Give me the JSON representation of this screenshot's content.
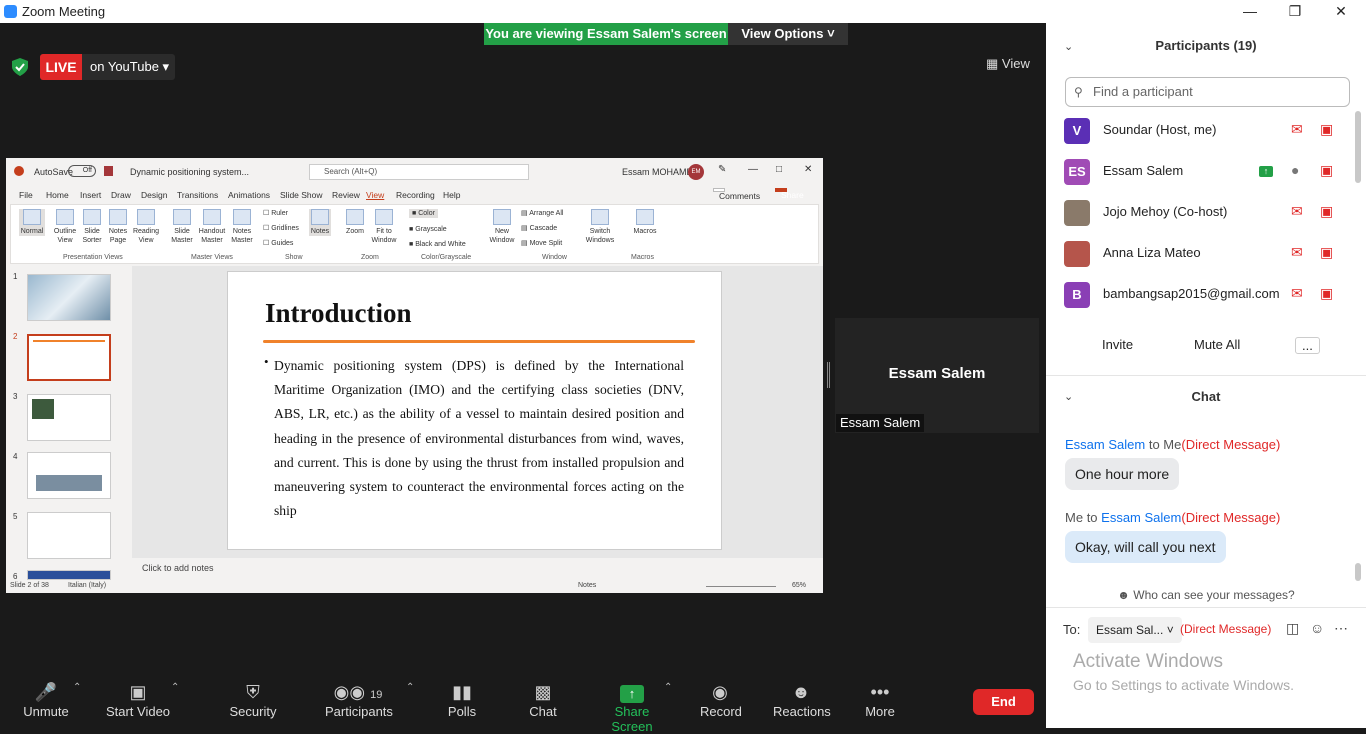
{
  "window": {
    "title": "Zoom Meeting"
  },
  "banner": {
    "viewing": "You are viewing Essam Salem's screen",
    "options": "View Options"
  },
  "live": {
    "badge": "LIVE",
    "platform": "on YouTube"
  },
  "view_label": "View",
  "ppt": {
    "autosave": "AutoSave",
    "off": "Off",
    "filename": "Dynamic positioning system...",
    "search": "Search (Alt+Q)",
    "user": "Essam MOHAMED",
    "user_initials": "EM",
    "menu": [
      "File",
      "Home",
      "Insert",
      "Draw",
      "Design",
      "Transitions",
      "Animations",
      "Slide Show",
      "Review",
      "View",
      "Recording",
      "Help"
    ],
    "comments": "Comments",
    "share": "Share",
    "ribbon": {
      "normal": "Normal",
      "outline": "Outline View",
      "sorter": "Slide Sorter",
      "notes_page": "Notes Page",
      "reading": "Reading View",
      "slide_master": "Slide Master",
      "handout": "Handout Master",
      "notes_master": "Notes Master",
      "ruler": "Ruler",
      "gridlines": "Gridlines",
      "guides": "Guides",
      "notes": "Notes",
      "zoom": "Zoom",
      "fit": "Fit to Window",
      "color": "Color",
      "grayscale": "Grayscale",
      "bw": "Black and White",
      "new_window": "New Window",
      "arrange": "Arrange All",
      "cascade": "Cascade",
      "move_split": "Move Split",
      "switch": "Switch Windows",
      "macros": "Macros",
      "groups": [
        "Presentation Views",
        "Master Views",
        "Show",
        "Zoom",
        "Color/Grayscale",
        "Window",
        "Macros"
      ]
    },
    "slide_numbers": [
      "1",
      "2",
      "3",
      "4",
      "5",
      "6"
    ],
    "slide": {
      "title": "Introduction",
      "body": "Dynamic positioning system (DPS) is defined by the International Maritime Organization (IMO) and the certifying class societies (DNV, ABS, LR, etc.) as the ability of a vessel to maintain desired position and heading in the presence of environmental disturbances from wind, waves, and current. This is done by using the thrust from installed propulsion and maneuvering system to counteract the environmental forces acting on the ship"
    },
    "notes_placeholder": "Click to add notes",
    "status": {
      "slide": "Slide 2 of 38",
      "lang": "Italian (Italy)",
      "notes": "Notes",
      "zoom": "65%"
    }
  },
  "tile": {
    "name": "Essam Salem",
    "label": "Essam Salem"
  },
  "toolbar": {
    "unmute": "Unmute",
    "video": "Start Video",
    "security": "Security",
    "participants": "Participants",
    "participants_count": "19",
    "polls": "Polls",
    "chat": "Chat",
    "share": "Share Screen",
    "record": "Record",
    "reactions": "Reactions",
    "more": "More",
    "end": "End"
  },
  "panel": {
    "participants_title": "Participants (19)",
    "search_placeholder": "Find a participant",
    "participants": [
      {
        "name": "Soundar (Host, me)",
        "initials": "V",
        "color": "#5b2fb5"
      },
      {
        "name": "Essam Salem",
        "initials": "ES",
        "color": "#a04bb5"
      },
      {
        "name": "Jojo Mehoy (Co-host)",
        "initials": "",
        "color": "#8a7a6a"
      },
      {
        "name": "Anna Liza Mateo",
        "initials": "",
        "color": "#b5554b"
      },
      {
        "name": "bambangsap2015@gmail.com",
        "initials": "B",
        "color": "#8a3fb5"
      }
    ],
    "invite": "Invite",
    "mute_all": "Mute All",
    "more": "...",
    "chat_title": "Chat",
    "messages": [
      {
        "from": "Essam Salem",
        "to": "Me",
        "dm": "(Direct Message)",
        "text": "One hour more"
      },
      {
        "from": "Me",
        "to": "Essam Salem",
        "dm": "(Direct Message)",
        "text": "Okay, will call you next"
      }
    ],
    "who_can_see": "Who can see your messages?",
    "to_label": "To:",
    "to_value": "Essam Sal...",
    "to_dm": "(Direct Message)",
    "activate_title": "Activate Windows",
    "activate_sub": "Go to Settings to activate Windows."
  }
}
